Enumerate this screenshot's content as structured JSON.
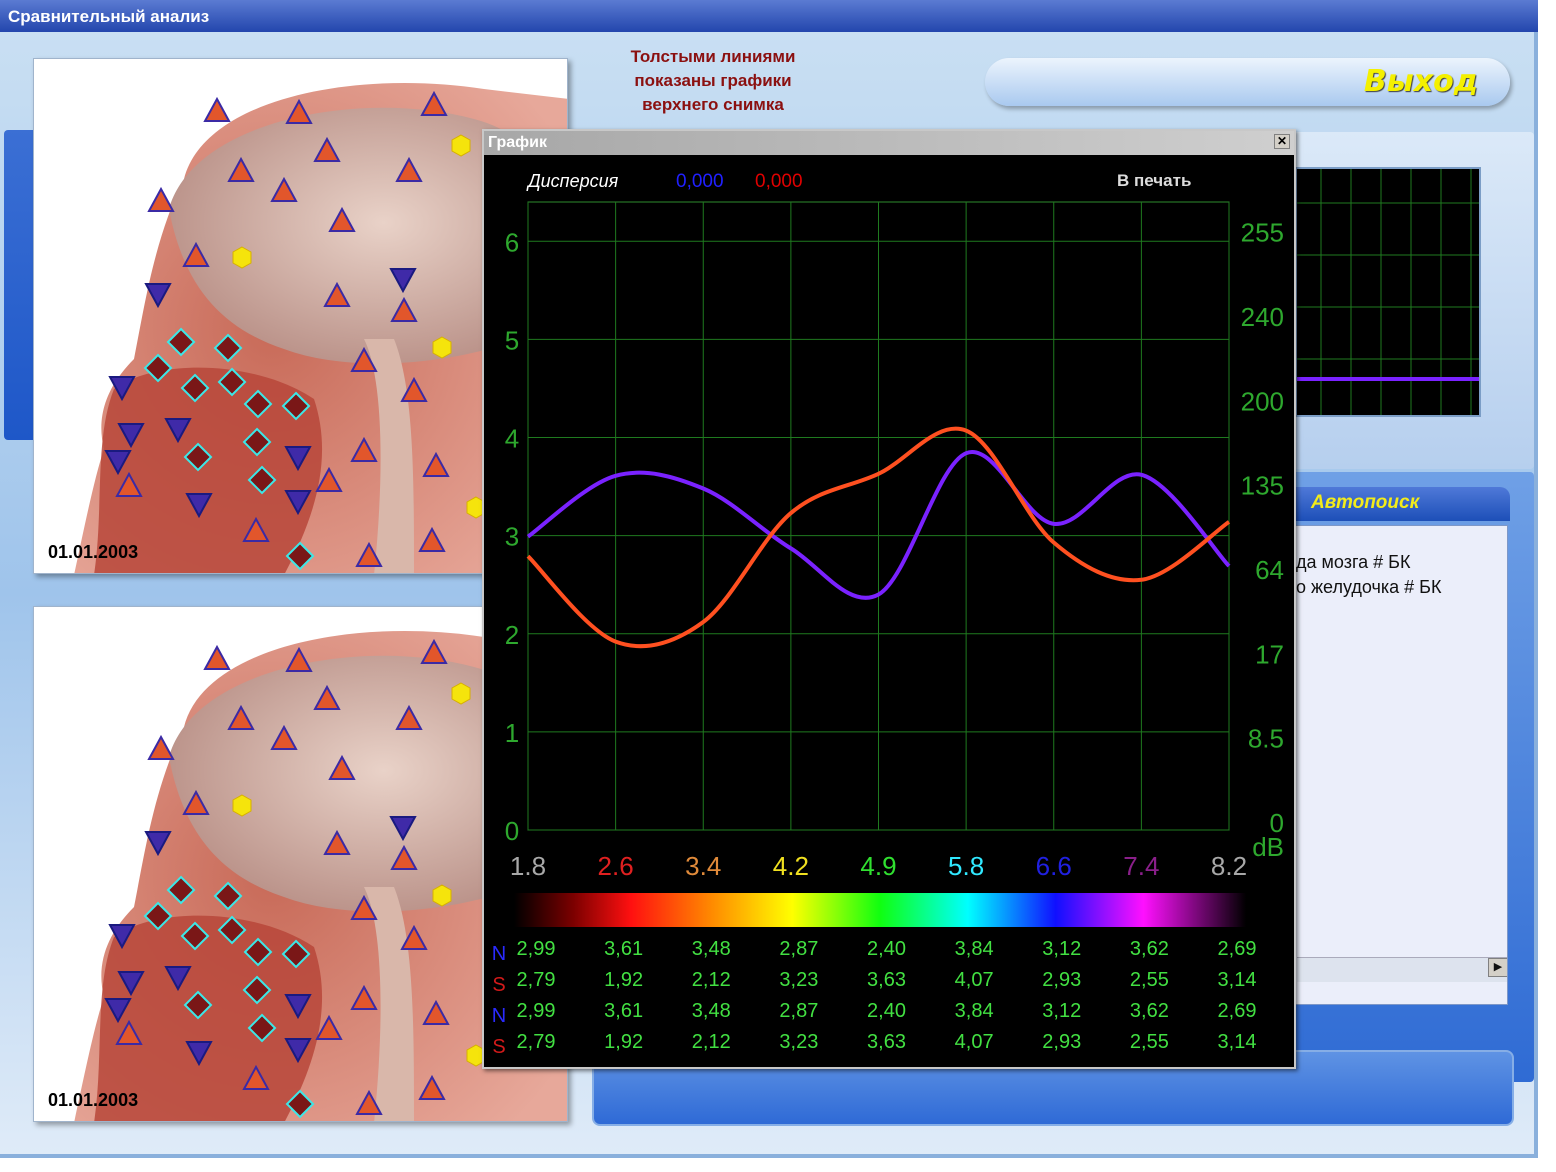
{
  "window": {
    "title": "Сравнительный анализ"
  },
  "header": {
    "exit_label": "Выход",
    "hint": "Толстыми линиями показаны графики верхнего снимка"
  },
  "images": [
    {
      "date": "01.01.2003"
    },
    {
      "date": "01.01.2003"
    }
  ],
  "autosearch": {
    "title": "Автопоиск",
    "items": [
      "да мозга # БК",
      "о  желудочка # БК"
    ]
  },
  "graph_dialog": {
    "title": "График",
    "dispersion_label": "Дисперсия",
    "dispersion_blue": "0,000",
    "dispersion_red": "0,000",
    "print_label": "В печать",
    "right_axis_unit": "dB"
  },
  "chart_data": {
    "type": "line",
    "x": [
      1.8,
      2.6,
      3.4,
      4.2,
      4.9,
      5.8,
      6.6,
      7.4,
      8.2
    ],
    "x_tick_labels": [
      "1.8",
      "2.6",
      "3.4",
      "4.2",
      "4.9",
      "5.8",
      "6.6",
      "7.4",
      "8.2"
    ],
    "x_tick_colors": [
      "#a8a8a8",
      "#e02020",
      "#e08a3a",
      "#f0e020",
      "#30e030",
      "#30e8ff",
      "#2020e0",
      "#8a1f8a",
      "#a8a8a8"
    ],
    "y_left_ticks": [
      "0",
      "1",
      "2",
      "3",
      "4",
      "5",
      "6"
    ],
    "y_left_range": [
      0,
      6.4
    ],
    "y_right_ticks": [
      "0",
      "8.5",
      "17",
      "64",
      "135",
      "200",
      "240",
      "255"
    ],
    "y_right_unit": "dB",
    "grid": true,
    "series": [
      {
        "values": [
          2.99,
          3.61,
          3.48,
          2.87,
          2.4,
          3.84,
          3.12,
          3.62,
          2.69
        ],
        "color": "#7a22ff"
      },
      {
        "values": [
          2.79,
          1.92,
          2.12,
          3.23,
          3.63,
          4.07,
          2.93,
          2.55,
          3.14
        ],
        "color": "#ff5020"
      }
    ],
    "table_rows": [
      {
        "label": "N",
        "label_color": "#2a2aff",
        "values": [
          "2,99",
          "3,61",
          "3,48",
          "2,87",
          "2,40",
          "3,84",
          "3,12",
          "3,62",
          "2,69"
        ]
      },
      {
        "label": "S",
        "label_color": "#d21a1a",
        "values": [
          "2,79",
          "1,92",
          "2,12",
          "3,23",
          "3,63",
          "4,07",
          "2,93",
          "2,55",
          "3,14"
        ]
      },
      {
        "label": "N",
        "label_color": "#2a2aff",
        "values": [
          "2,99",
          "3,61",
          "3,48",
          "2,87",
          "2,40",
          "3,84",
          "3,12",
          "3,62",
          "2,69"
        ]
      },
      {
        "label": "S",
        "label_color": "#d21a1a",
        "values": [
          "2,79",
          "1,92",
          "2,12",
          "3,23",
          "3,63",
          "4,07",
          "2,93",
          "2,55",
          "3,14"
        ]
      }
    ]
  }
}
